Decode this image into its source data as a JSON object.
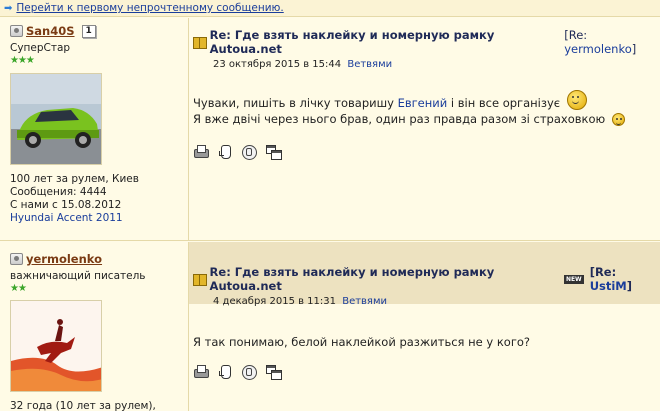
{
  "topbar": {
    "link": "Перейти к первому непрочтенному сообщению."
  },
  "posts": [
    {
      "username": "San40S",
      "badge": "1",
      "rank": "СуперСтар",
      "stars": "★★★",
      "info": [
        "100 лет за рулем, Киев",
        "Сообщения: 4444",
        "С нами с 15.08.2012"
      ],
      "car": "Hyundai Accent 2011",
      "title": "Re: Где взять наклейку и номерную рамку Autoua.net",
      "reply_prefix": "[Re: ",
      "reply_user": "yermolenko",
      "reply_suffix": "]",
      "date": "23 октября 2015 в 15:44",
      "branches": "Ветвями",
      "body_line1_pre": "Чуваки, пишіть в лічку товаришу ",
      "body_line1_link": "Евгений",
      "body_line1_post": " і він все організує",
      "body_line2": "Я вже двічі через нього брав, один раз правда разом зі страховкою"
    },
    {
      "username": "yermolenko",
      "rank": "важничающий писатель",
      "stars": "★★",
      "info": [
        "32 года (10 лет за рулем),"
      ],
      "title": "Re: Где взять наклейку и номерную рамку Autoua.net",
      "new_label": "NEW",
      "reply_prefix": "[Re: ",
      "reply_user": "UstiM",
      "reply_suffix": "]",
      "date": "4 декабря 2015 в 11:31",
      "branches": "Ветвями",
      "body": "Я так понимаю, белой наклейкой разжиться не у кого?"
    }
  ],
  "colors": {
    "username": "#7a3b14",
    "link": "#1a3d9b",
    "stars": "#3ca62a",
    "header_band": "#ede2c0",
    "page_bg": "#fffbe6"
  }
}
